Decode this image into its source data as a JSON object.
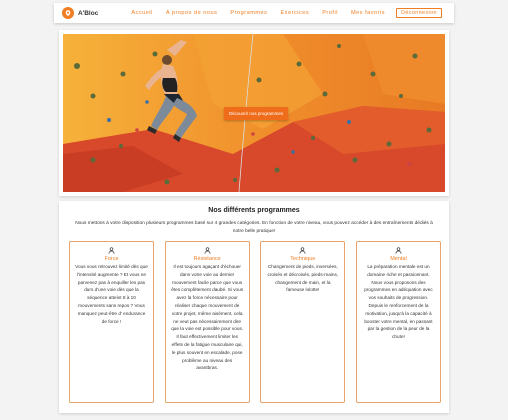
{
  "brand": {
    "name": "A'Bloc",
    "logo_icon": "climbing-hold-icon",
    "accent": "#ef7d22"
  },
  "nav": {
    "links": [
      "Accueil",
      "A propos de nous",
      "Programmes",
      "Exercices",
      "Profil",
      "Mes favoris"
    ],
    "logout_label": "Déconnexion"
  },
  "hero": {
    "image": "climber-on-orange-wall",
    "cta_label": "Découvrir nos programmes"
  },
  "programs": {
    "title": "Nos différents programmes",
    "intro": "Nous mettons à votre disposition plusieurs programmes basé sur 4 grandes catégories. En fonction de votre niveau, vous pouvez accéder à des entraînements dédiés à notre belle pratique!",
    "cards": [
      {
        "icon": "person-icon",
        "title": "Force",
        "text": "Vous vous retrouvez limité dès que l'intensité augmente ? Et vous ne parvenez pas à enquiller les pas durs d'une voie dès que la séquence atteint 8 à 10 mouvements sans repos ? Vous manquez peut-être d' endurance de force !"
      },
      {
        "icon": "person-icon",
        "title": "Résistance",
        "text": "Il est toujours agaçant d'échouer dans votre voie au dernier mouvement facile parce que vous êtes complètement daubé. Si vous avez la force nécessaire pour réaliser chaque mouvement de votre projet, même aisément, cela ne veut pas nécessairement dire que la voie est possible pour vous. Il faut effectivement limiter les effets de la fatigue musculaire qui, le plus souvent en escalade, pose problème au niveau des avantbras."
      },
      {
        "icon": "person-icon",
        "title": "Technique",
        "text": "Changement de pieds, inversées, croisés et décroisés, pieds-mains, changement de main, et la fameuse lolotte!"
      },
      {
        "icon": "person-icon",
        "title": "Mental",
        "text": "La préparation mentale est un domaine riche et passionnant. Nous vous proposons des programmes en adéquation avec vos souhaits de progression. Depuis le renforcement de la motivation, jusqu'à la capacité à booster votre mental, en passant par la gestion de la peur de la chute!"
      }
    ]
  }
}
